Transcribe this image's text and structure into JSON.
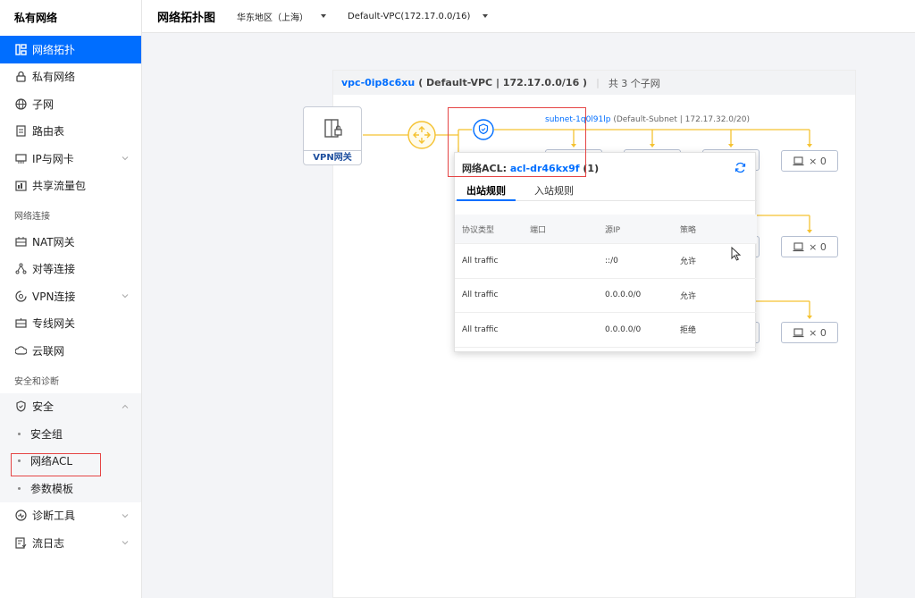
{
  "sidebar": {
    "title": "私有网络",
    "items_top": [
      {
        "label": "网络拓扑",
        "icon": "topology-icon",
        "active": true
      },
      {
        "label": "私有网络",
        "icon": "lock-icon"
      },
      {
        "label": "子网",
        "icon": "globe-icon"
      },
      {
        "label": "路由表",
        "icon": "route-table-icon"
      },
      {
        "label": "IP与网卡",
        "icon": "network-card-icon",
        "expandable": true
      },
      {
        "label": "共享流量包",
        "icon": "traffic-package-icon"
      }
    ],
    "section_connect": "网络连接",
    "items_connect": [
      {
        "label": "NAT网关",
        "icon": "nat-gateway-icon"
      },
      {
        "label": "对等连接",
        "icon": "peering-icon"
      },
      {
        "label": "VPN连接",
        "icon": "vpn-icon",
        "expandable": true
      },
      {
        "label": "专线网关",
        "icon": "direct-connect-icon"
      },
      {
        "label": "云联网",
        "icon": "ccn-icon"
      }
    ],
    "section_security": "安全和诊断",
    "security": {
      "label": "安全",
      "icon": "shield-icon"
    },
    "security_sub": [
      "安全组",
      "网络ACL",
      "参数模板"
    ],
    "items_bottom": [
      {
        "label": "诊断工具",
        "icon": "diagnose-icon",
        "expandable": true
      },
      {
        "label": "流日志",
        "icon": "flow-log-icon",
        "expandable": true
      }
    ]
  },
  "header": {
    "title": "网络拓扑图",
    "region": "华东地区（上海）",
    "vpc": "Default-VPC(172.17.0.0/16)"
  },
  "topology": {
    "vpc_id": "vpc-0ip8c6xu",
    "vpc_info": "( Default-VPC | 172.17.0.0/16 )",
    "subnet_count": "共  3  个子网",
    "vpn_label": "VPN网关",
    "subnet_id": "subnet-1q0l91lp",
    "subnet_info": " (Default-Subnet | 172.17.32.0/20)",
    "cvm_count": "×  0"
  },
  "acl_popover": {
    "title_prefix": "网络ACL: ",
    "acl_id": "acl-dr46kx9f",
    "acl_count": " (1)",
    "tabs": [
      "出站规则",
      "入站规则"
    ],
    "columns": [
      "协议类型",
      "端口",
      "源IP",
      "策略"
    ],
    "rows": [
      [
        "All traffic",
        "",
        "::/0",
        "允许"
      ],
      [
        "All traffic",
        "",
        "0.0.0.0/0",
        "允许"
      ],
      [
        "All traffic",
        "",
        "0.0.0.0/0",
        "拒绝"
      ]
    ]
  },
  "colors": {
    "accent": "#006eff",
    "line": "#f5c231",
    "highlight": "#e54545"
  }
}
